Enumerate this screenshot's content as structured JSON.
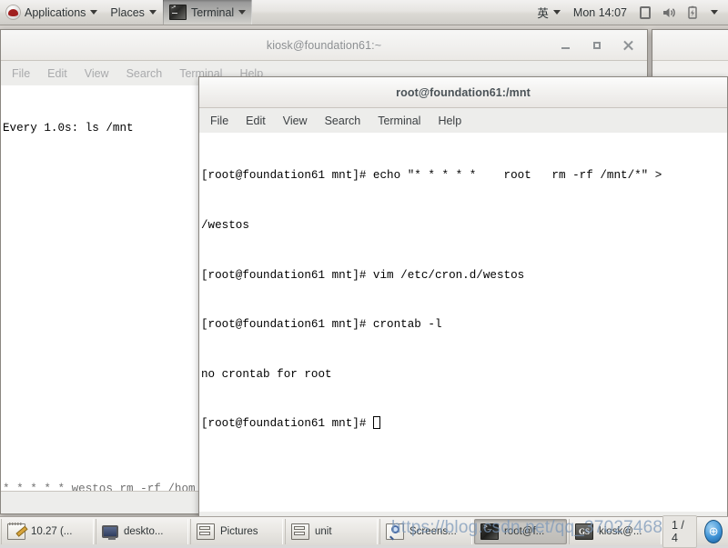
{
  "top_panel": {
    "applications_label": "Applications",
    "places_label": "Places",
    "terminal_label": "Terminal",
    "input_method_label": "英",
    "clock": "Mon 14:07",
    "icons": [
      "display-icon",
      "speaker-icon",
      "battery-icon",
      "system-menu-caret"
    ]
  },
  "windows": {
    "kiosk": {
      "title": "kiosk@foundation61:~",
      "menu": [
        "File",
        "Edit",
        "View",
        "Search",
        "Terminal",
        "Help"
      ],
      "terminal_first_line": "Every 1.0s: ls /mnt",
      "terminal_bottom_line": "* * * * * westos rm -rf /hom"
    },
    "root": {
      "title": "root@foundation61:/mnt",
      "menu": [
        "File",
        "Edit",
        "View",
        "Search",
        "Terminal",
        "Help"
      ],
      "lines": [
        "[root@foundation61 mnt]# echo \"* * * * *    root   rm -rf /mnt/*\" >",
        "/westos",
        "[root@foundation61 mnt]# vim /etc/cron.d/westos",
        "[root@foundation61 mnt]# crontab -l",
        "no crontab for root",
        "[root@foundation61 mnt]# "
      ]
    }
  },
  "taskbar": {
    "items": [
      {
        "label": "10.27 (...",
        "icon": "notepad-icon",
        "active": false
      },
      {
        "label": "deskto...",
        "icon": "monitor-icon",
        "active": false
      },
      {
        "label": "Pictures",
        "icon": "file-drawer-icon",
        "active": false
      },
      {
        "label": "unit",
        "icon": "file-drawer-icon",
        "active": false
      },
      {
        "label": "Screens...",
        "icon": "magnifier-icon",
        "active": false
      },
      {
        "label": "root@f...",
        "icon": "terminal-icon",
        "active": true
      },
      {
        "label": "kiosk@...",
        "icon": "gs-icon",
        "active": false
      }
    ],
    "workspace": "1 / 4",
    "workspace_globe_label": "⊕"
  },
  "watermark": {
    "text": "https://blog.csdn.net/qq_37027468"
  },
  "colors": {
    "panel_bg": "#e6e4e1",
    "desktop_bg": "#d7d3ce",
    "terminal_bg": "#ffffff",
    "terminal_fg": "#000000",
    "title_active_fg": "#4a5257",
    "title_inactive_fg": "#8d9093",
    "taskbar_active_bg": "#bebcb7"
  }
}
